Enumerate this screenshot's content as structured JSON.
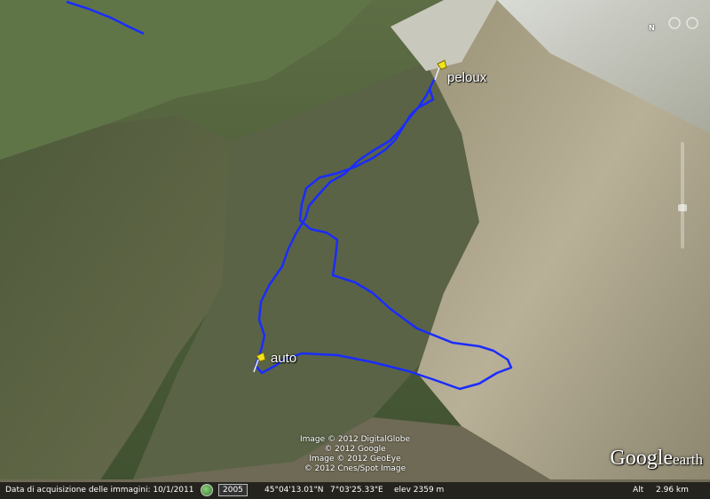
{
  "placemarks": [
    {
      "label": "peloux"
    },
    {
      "label": "auto"
    }
  ],
  "credits": [
    "Image © 2012 DigitalGlobe",
    "© 2012 Google",
    "Image © 2012 GeoEye",
    "© 2012 Cnes/Spot Image"
  ],
  "logo": {
    "word1": "Google",
    "word2": "earth"
  },
  "compass": {
    "north_label": "N"
  },
  "status": {
    "imagery_date": "Data di acquisizione delle immagini: 10/1/2011",
    "historical_year": "2005",
    "latitude": "45°04'13.01\"N",
    "longitude": "7°03'25.33\"E",
    "elevation": "elev  2359 m",
    "altitude_label": "Alt",
    "altitude_value": "2.96 km"
  },
  "colors": {
    "track": "#1a2cff",
    "secondary_track": "#1a2cff",
    "pin": "#f2e21a",
    "label": "#ffffff"
  },
  "icons": [
    "pushpin-icon",
    "historical-imagery-icon",
    "compass-icon",
    "zoom-slider-icon"
  ]
}
